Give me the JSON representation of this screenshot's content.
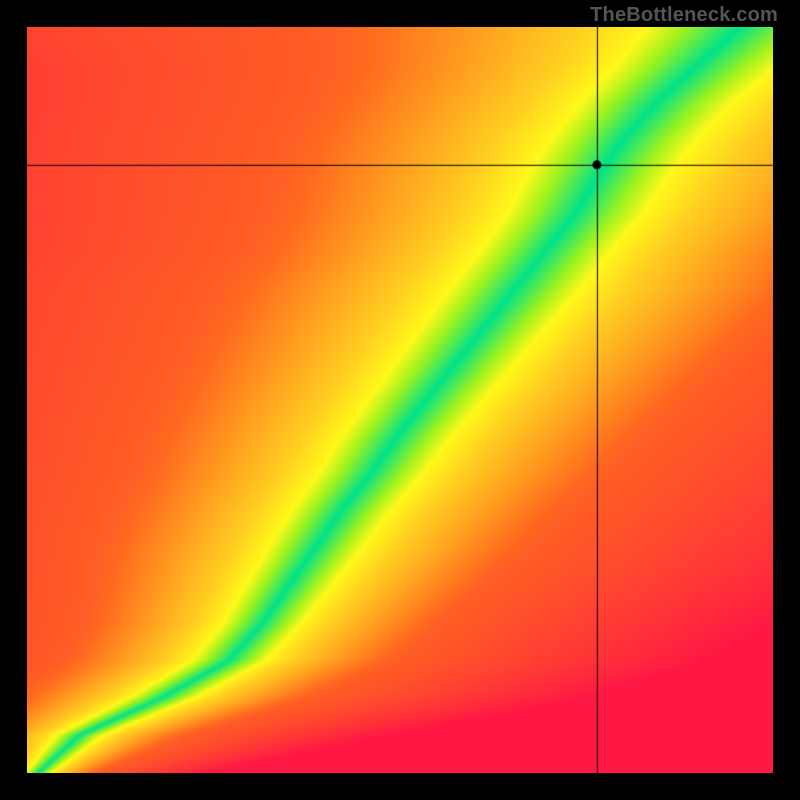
{
  "watermark": "TheBottleneck.com",
  "chart_data": {
    "type": "heatmap",
    "title": "",
    "xlabel": "",
    "ylabel": "",
    "axis_range": {
      "x": [
        0,
        1
      ],
      "y": [
        0,
        1
      ]
    },
    "marker": {
      "x": 0.765,
      "y": 0.815,
      "note": "black dot + crosshair lines at approx (0.765, 0.815) in normalized plot coords"
    },
    "colormap": {
      "description": "distance from optimal-balance ridge mapped red→orange→yellow→green",
      "stops": [
        {
          "t": 0.0,
          "hex": "#ff1844"
        },
        {
          "t": 0.35,
          "hex": "#ff6a1f"
        },
        {
          "t": 0.6,
          "hex": "#ffd020"
        },
        {
          "t": 0.8,
          "hex": "#fff81a"
        },
        {
          "t": 0.92,
          "hex": "#9cf21f"
        },
        {
          "t": 1.0,
          "hex": "#00e28a"
        }
      ]
    },
    "ridge": {
      "description": "approximate x-positions of the green (optimal) band center and half-width at sampled y levels, normalized 0..1, y measured from BOTTOM of plot",
      "points": [
        {
          "y": 0.0,
          "x": 0.015,
          "w": 0.01
        },
        {
          "y": 0.05,
          "x": 0.07,
          "w": 0.018
        },
        {
          "y": 0.1,
          "x": 0.18,
          "w": 0.025
        },
        {
          "y": 0.15,
          "x": 0.27,
          "w": 0.028
        },
        {
          "y": 0.2,
          "x": 0.315,
          "w": 0.03
        },
        {
          "y": 0.25,
          "x": 0.35,
          "w": 0.033
        },
        {
          "y": 0.3,
          "x": 0.385,
          "w": 0.036
        },
        {
          "y": 0.35,
          "x": 0.42,
          "w": 0.038
        },
        {
          "y": 0.4,
          "x": 0.46,
          "w": 0.04
        },
        {
          "y": 0.45,
          "x": 0.495,
          "w": 0.042
        },
        {
          "y": 0.5,
          "x": 0.535,
          "w": 0.044
        },
        {
          "y": 0.55,
          "x": 0.575,
          "w": 0.046
        },
        {
          "y": 0.6,
          "x": 0.615,
          "w": 0.048
        },
        {
          "y": 0.65,
          "x": 0.655,
          "w": 0.05
        },
        {
          "y": 0.7,
          "x": 0.695,
          "w": 0.05
        },
        {
          "y": 0.75,
          "x": 0.735,
          "w": 0.052
        },
        {
          "y": 0.8,
          "x": 0.765,
          "w": 0.054
        },
        {
          "y": 0.85,
          "x": 0.8,
          "w": 0.056
        },
        {
          "y": 0.9,
          "x": 0.845,
          "w": 0.058
        },
        {
          "y": 0.95,
          "x": 0.9,
          "w": 0.062
        },
        {
          "y": 1.0,
          "x": 0.955,
          "w": 0.07
        }
      ]
    }
  }
}
